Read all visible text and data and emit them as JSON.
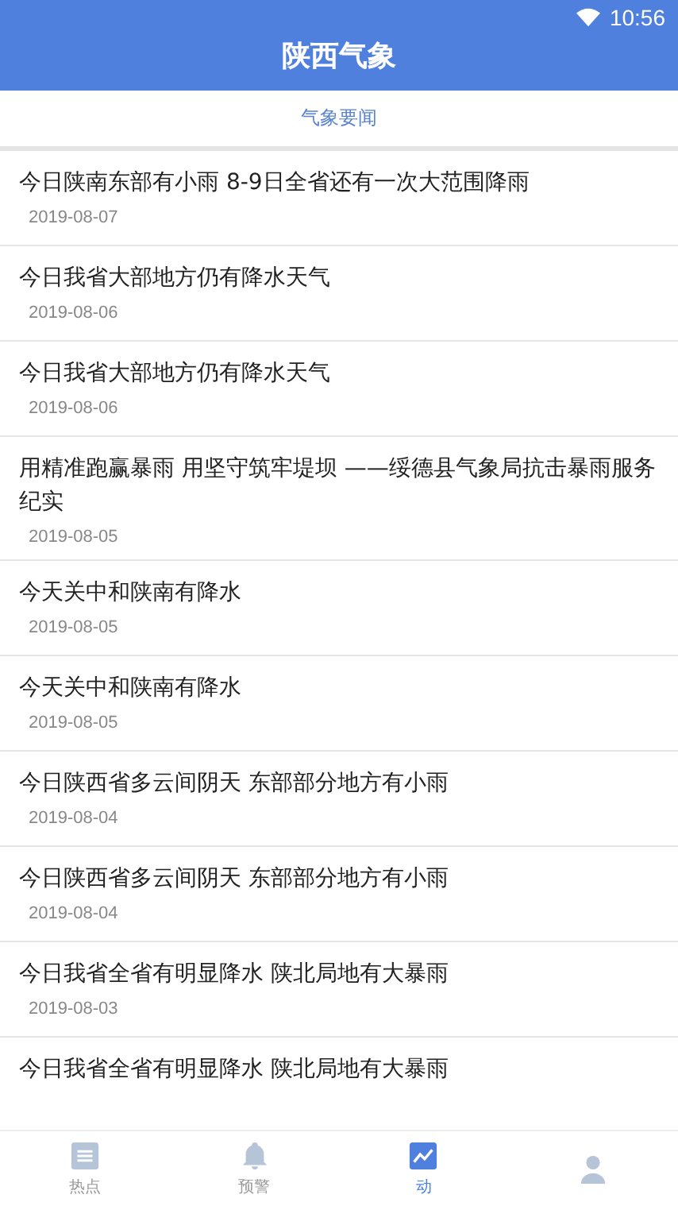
{
  "status_bar": {
    "time": "10:56"
  },
  "header": {
    "title": "陕西气象"
  },
  "tabs": [
    {
      "label": "气象要闻",
      "selected": true
    }
  ],
  "news": [
    {
      "title": "今日陕南东部有小雨 8-9日全省还有一次大范围降雨",
      "date": "2019-08-07"
    },
    {
      "title": "今日我省大部地方仍有降水天气",
      "date": "2019-08-06"
    },
    {
      "title": "今日我省大部地方仍有降水天气",
      "date": "2019-08-06"
    },
    {
      "title": "用精准跑赢暴雨 用坚守筑牢堤坝 ——绥德县气象局抗击暴雨服务纪实",
      "date": "2019-08-05"
    },
    {
      "title": "今天关中和陕南有降水",
      "date": "2019-08-05"
    },
    {
      "title": "今天关中和陕南有降水",
      "date": "2019-08-05"
    },
    {
      "title": "今日陕西省多云间阴天 东部部分地方有小雨",
      "date": "2019-08-04"
    },
    {
      "title": "今日陕西省多云间阴天 东部部分地方有小雨",
      "date": "2019-08-04"
    },
    {
      "title": "今日我省全省有明显降水 陕北局地有大暴雨",
      "date": "2019-08-03"
    },
    {
      "title": "今日我省全省有明显降水 陕北局地有大暴雨"
    }
  ],
  "bottom_nav": [
    {
      "kind": "news",
      "label": "热点",
      "selected": false
    },
    {
      "kind": "bell",
      "label": "预警",
      "selected": false
    },
    {
      "kind": "chart",
      "label": "动",
      "selected": true
    },
    {
      "kind": "person",
      "selected": false
    }
  ]
}
